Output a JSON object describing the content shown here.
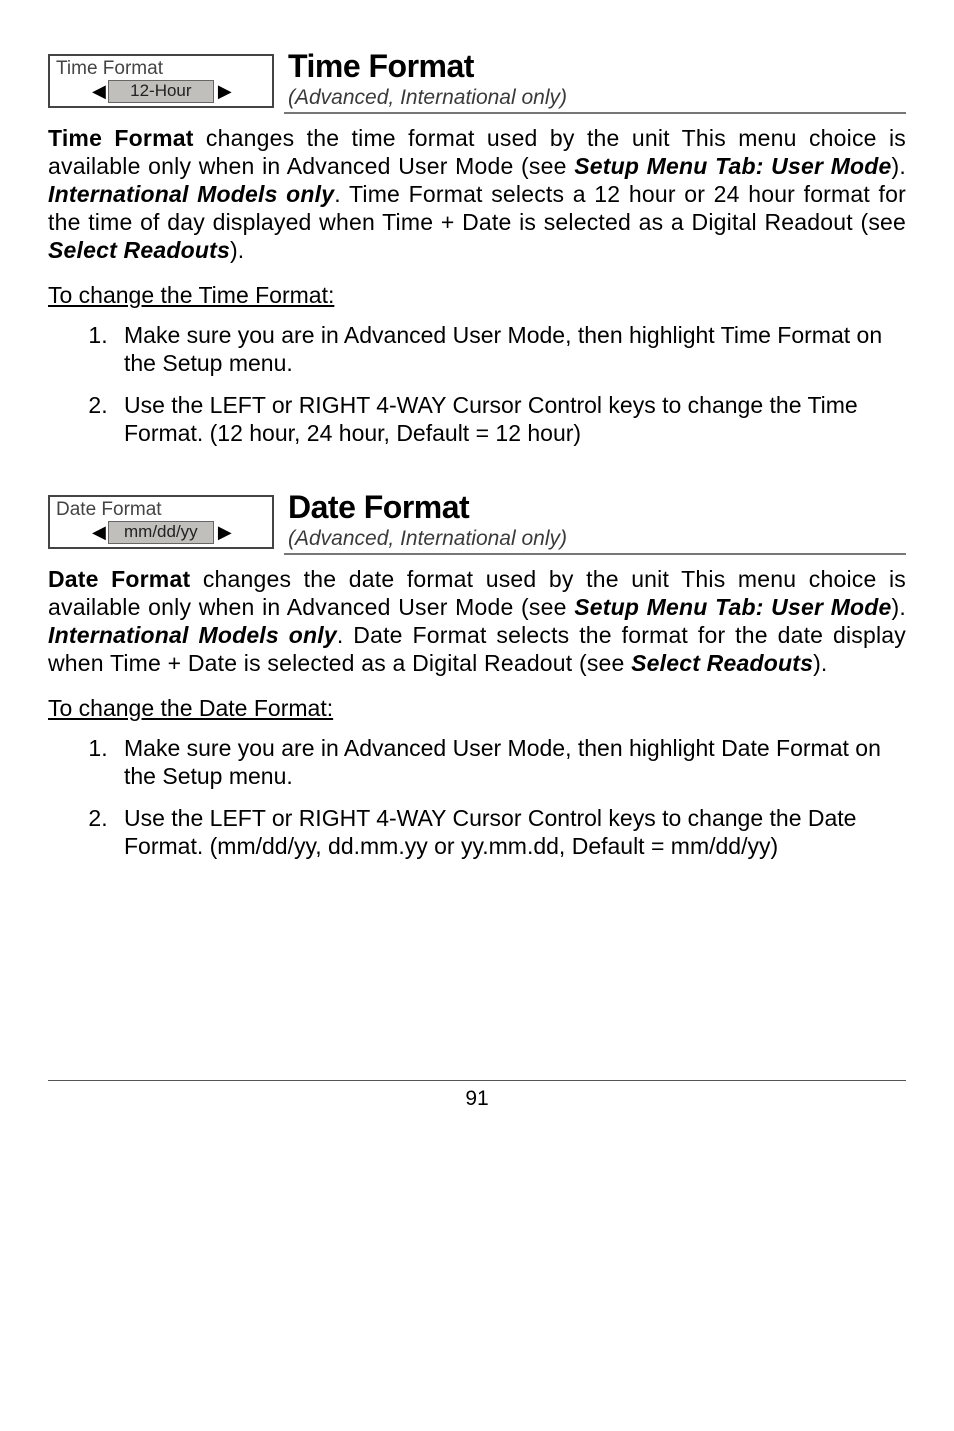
{
  "section1": {
    "ui": {
      "title": "Time Format",
      "value": "12-Hour"
    },
    "heading": "Time Format",
    "subtitle": "(Advanced, International only)",
    "para": {
      "lead_bold": "Time Format",
      "t1": " changes the time format used by the unit This menu choice is available only when in Advanced User Mode (see ",
      "bi1": "Setup Menu Tab: User Mode",
      "t2": "). ",
      "bi2": "International Models only",
      "t3": ". Time Format selects a 12 hour or 24 hour format for the time of day displayed when Time + Date is selected as a Digital Readout (see ",
      "bi3": "Select Readouts",
      "t4": ")."
    },
    "subheading": "To change the Time Format:",
    "steps": [
      "Make sure you are in Advanced User Mode, then highlight Time Format on the Setup menu.",
      "Use the LEFT or RIGHT 4-WAY Cursor Control keys to change the Time Format. (12 hour, 24 hour, Default = 12 hour)"
    ]
  },
  "section2": {
    "ui": {
      "title": "Date Format",
      "value": "mm/dd/yy"
    },
    "heading": "Date Format",
    "subtitle": "(Advanced, International only)",
    "para": {
      "lead_bold": "Date Format",
      "t1": " changes the date format used by the unit This menu choice is available only when in Advanced User Mode (see ",
      "bi1": "Setup Menu Tab: User Mode",
      "t2": "). ",
      "bi2": "International Models only",
      "t3": ". Date Format selects the format for the date display when Time + Date is selected as a Digital Readout (see ",
      "bi3": "Select Readouts",
      "t4": ")."
    },
    "subheading": "To change the Date Format:",
    "steps": [
      "Make sure you are in Advanced User Mode, then highlight Date Format on the Setup menu.",
      "Use the LEFT or RIGHT 4-WAY Cursor Control keys to change the Date Format. (mm/dd/yy, dd.mm.yy or yy.mm.dd, Default = mm/dd/yy)"
    ]
  },
  "page_number": "91"
}
